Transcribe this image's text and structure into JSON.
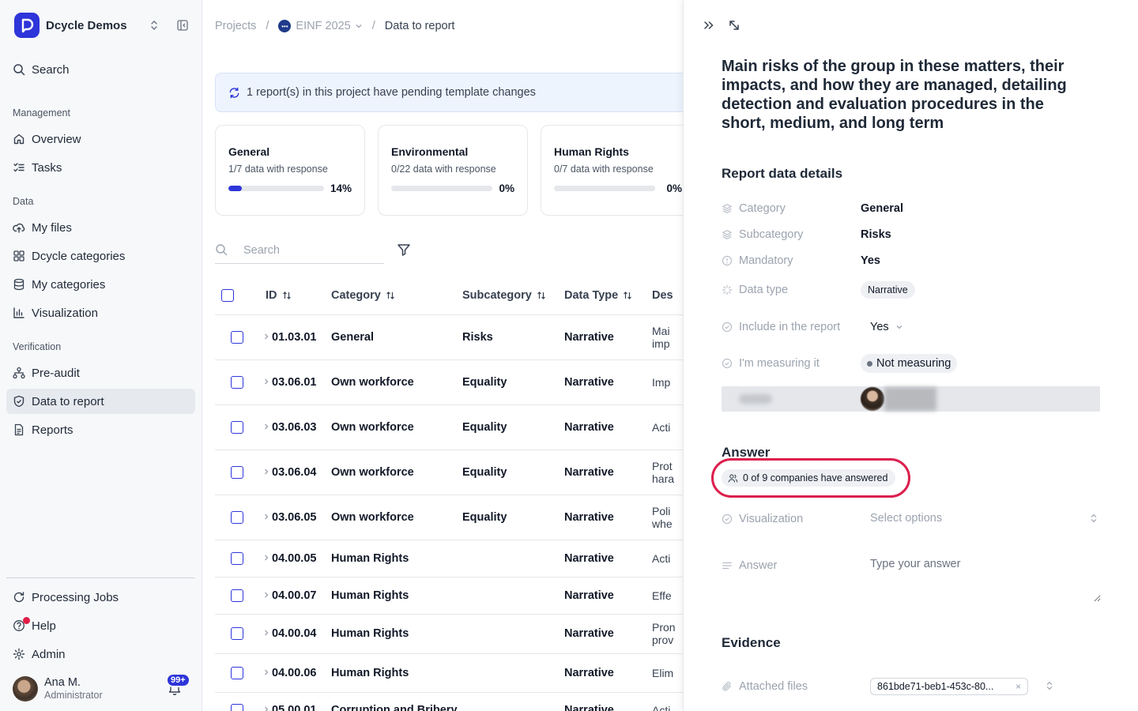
{
  "sidebar": {
    "org_name": "Dcycle Demos",
    "search_label": "Search",
    "sections": {
      "management": "Management",
      "data": "Data",
      "verification": "Verification"
    },
    "items": {
      "overview": "Overview",
      "tasks": "Tasks",
      "my_files": "My files",
      "dcycle_categories": "Dcycle categories",
      "my_categories": "My categories",
      "visualization": "Visualization",
      "pre_audit": "Pre-audit",
      "data_to_report": "Data to report",
      "reports": "Reports",
      "processing_jobs": "Processing Jobs",
      "help": "Help",
      "admin": "Admin"
    },
    "user": {
      "name": "Ana M.",
      "role": "Administrator",
      "notifications": "99+"
    },
    "accent_color": "#2e35d9"
  },
  "breadcrumbs": {
    "projects": "Projects",
    "project": "EINF 2025",
    "current": "Data to report"
  },
  "banner": {
    "text": "1 report(s) in this project have pending template changes"
  },
  "summary_cards": [
    {
      "title": "General",
      "subtitle": "1/7 data with response",
      "percent_label": "14%",
      "progress": 0.14
    },
    {
      "title": "Environmental",
      "subtitle": "0/22 data with response",
      "percent_label": "0%",
      "progress": 0
    },
    {
      "title": "Human Rights",
      "subtitle": "0/7 data with response",
      "percent_label": "0%",
      "progress": 0
    }
  ],
  "search": {
    "placeholder": "Search"
  },
  "table": {
    "headers": {
      "id": "ID",
      "category": "Category",
      "subcategory": "Subcategory",
      "data_type": "Data Type",
      "description": "Des"
    },
    "rows": [
      {
        "id": "01.03.01",
        "category": "General",
        "subcategory": "Risks",
        "data_type": "Narrative",
        "description": "Mai imp"
      },
      {
        "id": "03.06.01",
        "category": "Own workforce",
        "subcategory": "Equality",
        "data_type": "Narrative",
        "description": "Imp"
      },
      {
        "id": "03.06.03",
        "category": "Own workforce",
        "subcategory": "Equality",
        "data_type": "Narrative",
        "description": "Acti"
      },
      {
        "id": "03.06.04",
        "category": "Own workforce",
        "subcategory": "Equality",
        "data_type": "Narrative",
        "description": "Prot hara"
      },
      {
        "id": "03.06.05",
        "category": "Own workforce",
        "subcategory": "Equality",
        "data_type": "Narrative",
        "description": "Poli whe"
      },
      {
        "id": "04.00.05",
        "category": "Human Rights",
        "subcategory": "",
        "data_type": "Narrative",
        "description": "Acti"
      },
      {
        "id": "04.00.07",
        "category": "Human Rights",
        "subcategory": "",
        "data_type": "Narrative",
        "description": "Effe"
      },
      {
        "id": "04.00.04",
        "category": "Human Rights",
        "subcategory": "",
        "data_type": "Narrative",
        "description": "Pron prov"
      },
      {
        "id": "04.00.06",
        "category": "Human Rights",
        "subcategory": "",
        "data_type": "Narrative",
        "description": "Elim"
      },
      {
        "id": "05.00.01",
        "category": "Corruption and Bribery",
        "subcategory": "",
        "data_type": "Narrative",
        "description": "Acti"
      }
    ]
  },
  "panel": {
    "title": "Main risks of the group in these matters, their impacts, and how they are managed, detailing detection and evaluation procedures in the short, medium, and long term",
    "details_heading": "Report data details",
    "labels": {
      "category": "Category",
      "subcategory": "Subcategory",
      "mandatory": "Mandatory",
      "data_type": "Data type",
      "include": "Include in the report",
      "measuring": "I'm measuring it",
      "visualization": "Visualization",
      "answer": "Answer",
      "attached_files": "Attached files"
    },
    "values": {
      "category": "General",
      "subcategory": "Risks",
      "mandatory": "Yes",
      "data_type": "Narrative",
      "include": "Yes",
      "measuring": "Not measuring"
    },
    "answer_heading": "Answer",
    "answered_badge": "0 of 9 companies have answered",
    "visualization_placeholder": "Select options",
    "answer_placeholder": "Type your answer",
    "evidence_heading": "Evidence",
    "attached_file": "861bde71-beb1-453c-80..."
  }
}
